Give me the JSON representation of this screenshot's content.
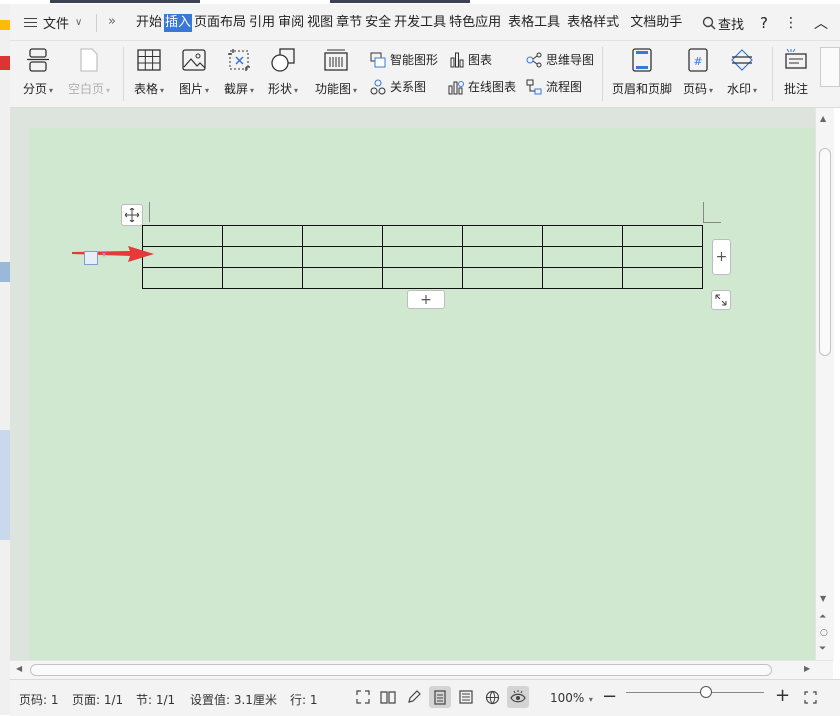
{
  "menu": {
    "file_label": "文件",
    "tabs": [
      {
        "label": "开始",
        "active": false
      },
      {
        "label": "插入",
        "active": true
      },
      {
        "label": "页面布局",
        "active": false
      },
      {
        "label": "引用",
        "active": false
      },
      {
        "label": "审阅",
        "active": false
      },
      {
        "label": "视图",
        "active": false
      },
      {
        "label": "章节",
        "active": false
      },
      {
        "label": "安全",
        "active": false
      },
      {
        "label": "开发工具",
        "active": false
      },
      {
        "label": "特色应用",
        "active": false
      },
      {
        "label": "表格工具",
        "active": false
      },
      {
        "label": "表格样式",
        "active": false
      },
      {
        "label": "文档助手",
        "active": false
      }
    ],
    "search_label": "查找",
    "help_label": "?",
    "more_label": "⋮",
    "collapse_label": "︿"
  },
  "ribbon": {
    "page_break": "分页",
    "blank_page": "空白页",
    "table": "表格",
    "picture": "图片",
    "screenshot": "截屏",
    "shape": "形状",
    "function_chart": "功能图",
    "smart_shape": "智能图形",
    "chart": "图表",
    "mind_map": "思维导图",
    "relation_chart": "关系图",
    "online_chart": "在线图表",
    "flow_chart": "流程图",
    "header_footer": "页眉和页脚",
    "page_number": "页码",
    "watermark": "水印",
    "comment": "批注"
  },
  "table": {
    "rows": 3,
    "cols": 7
  },
  "status": {
    "page_no": "页码: 1",
    "pages": "页面: 1/1",
    "section": "节: 1/1",
    "setting": "设置值: 3.1厘米",
    "row": "行: 1",
    "zoom": "100%",
    "zoom_level_percent": 100
  },
  "colors": {
    "accent": "#3a78d8",
    "page_bg": "#cfe8cf",
    "arrow": "#e8393a"
  }
}
